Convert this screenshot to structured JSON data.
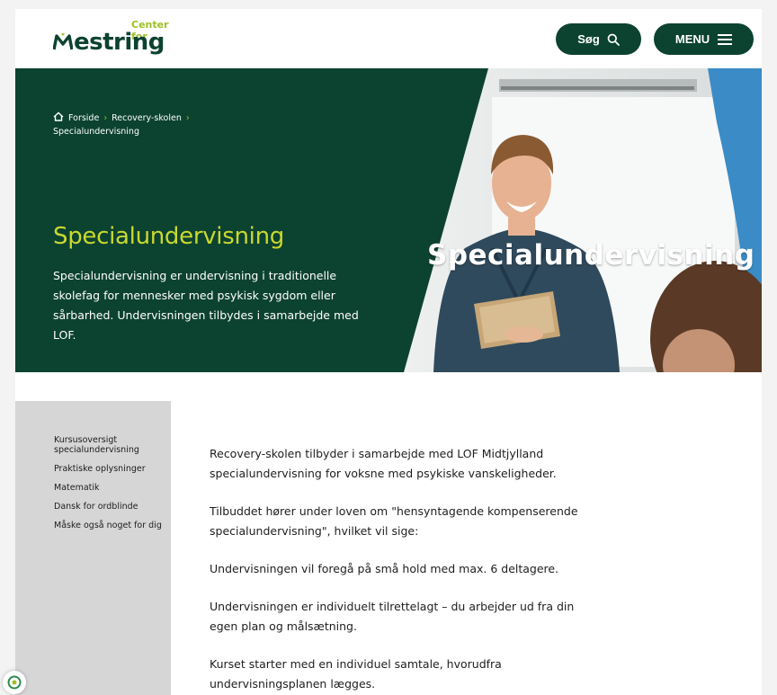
{
  "header": {
    "logo_small": "Center for",
    "logo_big": "estring",
    "logo_mark": "M",
    "search_label": "Søg",
    "menu_label": "MENU"
  },
  "breadcrumb": {
    "items": [
      "Forside",
      "Recovery-skolen",
      "Specialundervisning"
    ]
  },
  "hero": {
    "title": "Specialundervisning",
    "description": "Specialundervisning er undervisning i traditionelle skolefag for mennesker med psykisk sygdom eller sårbarhed. Undervisningen tilbydes i samarbejde med LOF.",
    "image_text": "Specialundervisning"
  },
  "sidebar": {
    "items": [
      "Kursusoversigt specialundervisning",
      "Praktiske oplysninger",
      "Matematik",
      "Dansk for ordblinde",
      "Måske også noget for dig"
    ]
  },
  "content": {
    "paragraphs": [
      "Recovery-skolen tilbyder i samarbejde med LOF Midtjylland specialundervisning for voksne med psykiske vanskeligheder.",
      "Tilbuddet hører under loven om \"hensyntagende kompenserende specialundervisning\", hvilket vil sige:",
      "Undervisningen vil foregå på små hold med max. 6 deltagere.",
      "Undervisningen er individuelt tilrettelagt – du arbejder ud fra din egen plan og målsætning.",
      "Kurset starter med en individuel samtale, hvorudfra undervisningsplanen lægges."
    ]
  },
  "colors": {
    "brand_green": "#0c4230",
    "accent_lime": "#c8d92e",
    "sidebar_gray": "#d6d6d6"
  },
  "icons": [
    "home-icon",
    "search-icon",
    "hamburger-menu-icon",
    "accessibility-icon"
  ]
}
